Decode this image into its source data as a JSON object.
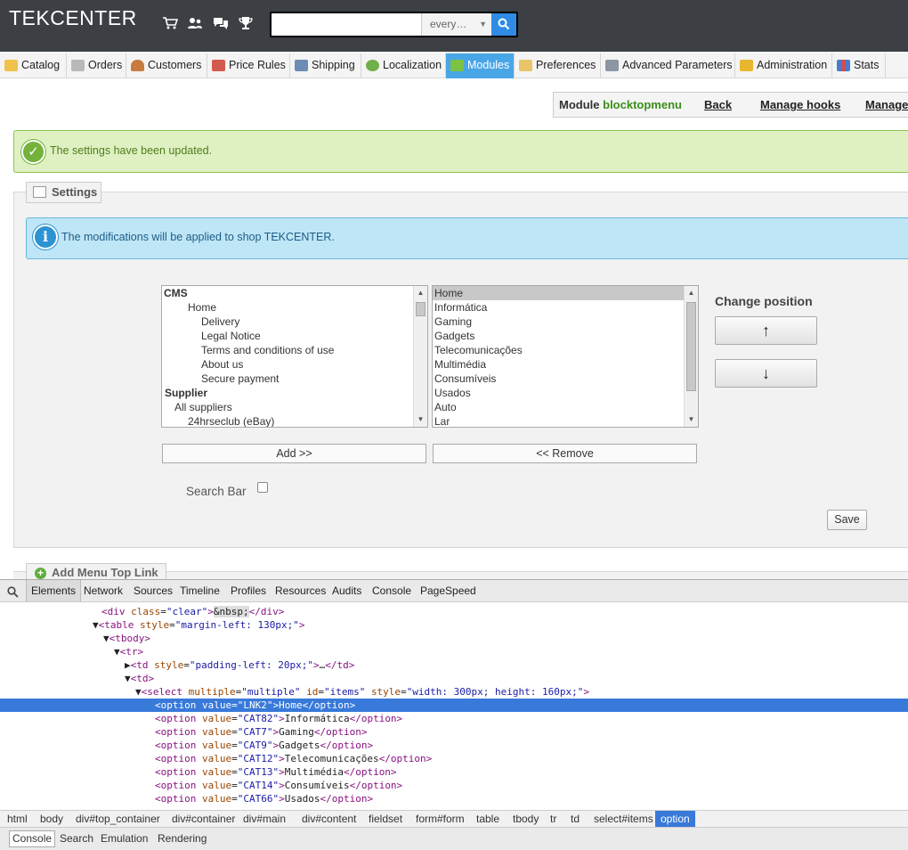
{
  "header": {
    "brand": "TEKCENTER",
    "icons": [
      "cart-icon",
      "customers-icon",
      "messages-icon",
      "trophy-icon"
    ],
    "search": {
      "value": "",
      "scope": "every…"
    }
  },
  "tabs": [
    {
      "label": "Catalog"
    },
    {
      "label": "Orders"
    },
    {
      "label": "Customers"
    },
    {
      "label": "Price Rules"
    },
    {
      "label": "Shipping"
    },
    {
      "label": "Localization"
    },
    {
      "label": "Modules"
    },
    {
      "label": "Preferences"
    },
    {
      "label": "Advanced Parameters"
    },
    {
      "label": "Administration"
    },
    {
      "label": "Stats"
    }
  ],
  "active_tab": "Modules",
  "toolbar": {
    "module_prefix": "Module",
    "module_name": "blocktopmenu",
    "back": "Back",
    "manage_hooks": "Manage hooks",
    "manage": "Manage"
  },
  "success_message": "The settings have been updated.",
  "settings": {
    "legend": "Settings",
    "info": "The modifications will be applied to shop TEKCENTER.",
    "available_items": [
      "CMS",
      "Home",
      "Delivery",
      "Legal Notice",
      "Terms and conditions of use",
      "About us",
      "Secure payment",
      "Supplier",
      "All suppliers",
      "24hrseclub (eBay)"
    ],
    "selected_items": [
      "Home",
      "Informática",
      "Gaming",
      "Gadgets",
      "Telecomunicações",
      "Multimédia",
      "Consumíveis",
      "Usados",
      "Auto",
      "Lar"
    ],
    "change_position": "Change position",
    "up": "↑",
    "down": "↓",
    "add": "Add >>",
    "remove": "<< Remove",
    "search_bar": "Search Bar",
    "save": "Save"
  },
  "add_menu_legend": "Add Menu Top Link",
  "devtools": {
    "tabs": [
      "Elements",
      "Network",
      "Sources",
      "Timeline",
      "Profiles",
      "Resources",
      "Audits",
      "Console",
      "PageSpeed"
    ],
    "code": {
      "l1": {
        "open": "<div ",
        "a1": "class",
        "v1": "\"clear\"",
        "gt": ">",
        "text": "&nbsp;",
        "close": "</div>"
      },
      "l2": {
        "open": "<table ",
        "a1": "style",
        "v1": "\"margin-left: 130px;\"",
        "gt": ">"
      },
      "l3": {
        "tag": "<tbody>"
      },
      "l4": {
        "tag": "<tr>"
      },
      "l5": {
        "open": "<td ",
        "a1": "style",
        "v1": "\"padding-left: 20px;\"",
        "gt": ">",
        "text": "…",
        "close": "</td>"
      },
      "l6": {
        "tag": "<td>"
      },
      "l7": {
        "open": "<select ",
        "a1": "multiple",
        "v1": "\"multiple\"",
        "a2": "id",
        "v2": "\"items\"",
        "a3": "style",
        "v3": "\"width: 300px; height: 160px;\"",
        "gt": ">"
      },
      "options": [
        {
          "value": "\"LNK2\"",
          "text": "Home"
        },
        {
          "value": "\"CAT82\"",
          "text": "Informática"
        },
        {
          "value": "\"CAT7\"",
          "text": "Gaming"
        },
        {
          "value": "\"CAT9\"",
          "text": "Gadgets"
        },
        {
          "value": "\"CAT12\"",
          "text": "Telecomunicações"
        },
        {
          "value": "\"CAT13\"",
          "text": "Multimédia"
        },
        {
          "value": "\"CAT14\"",
          "text": "Consumíveis"
        },
        {
          "value": "\"CAT66\"",
          "text": "Usados"
        }
      ]
    },
    "breadcrumbs": [
      "html",
      "body",
      "div#top_container",
      "div#container",
      "div#main",
      "div#content",
      "fieldset",
      "form#form",
      "table",
      "tbody",
      "tr",
      "td",
      "select#items",
      "option"
    ],
    "drawer_tabs": [
      "Console",
      "Search",
      "Emulation",
      "Rendering"
    ]
  }
}
